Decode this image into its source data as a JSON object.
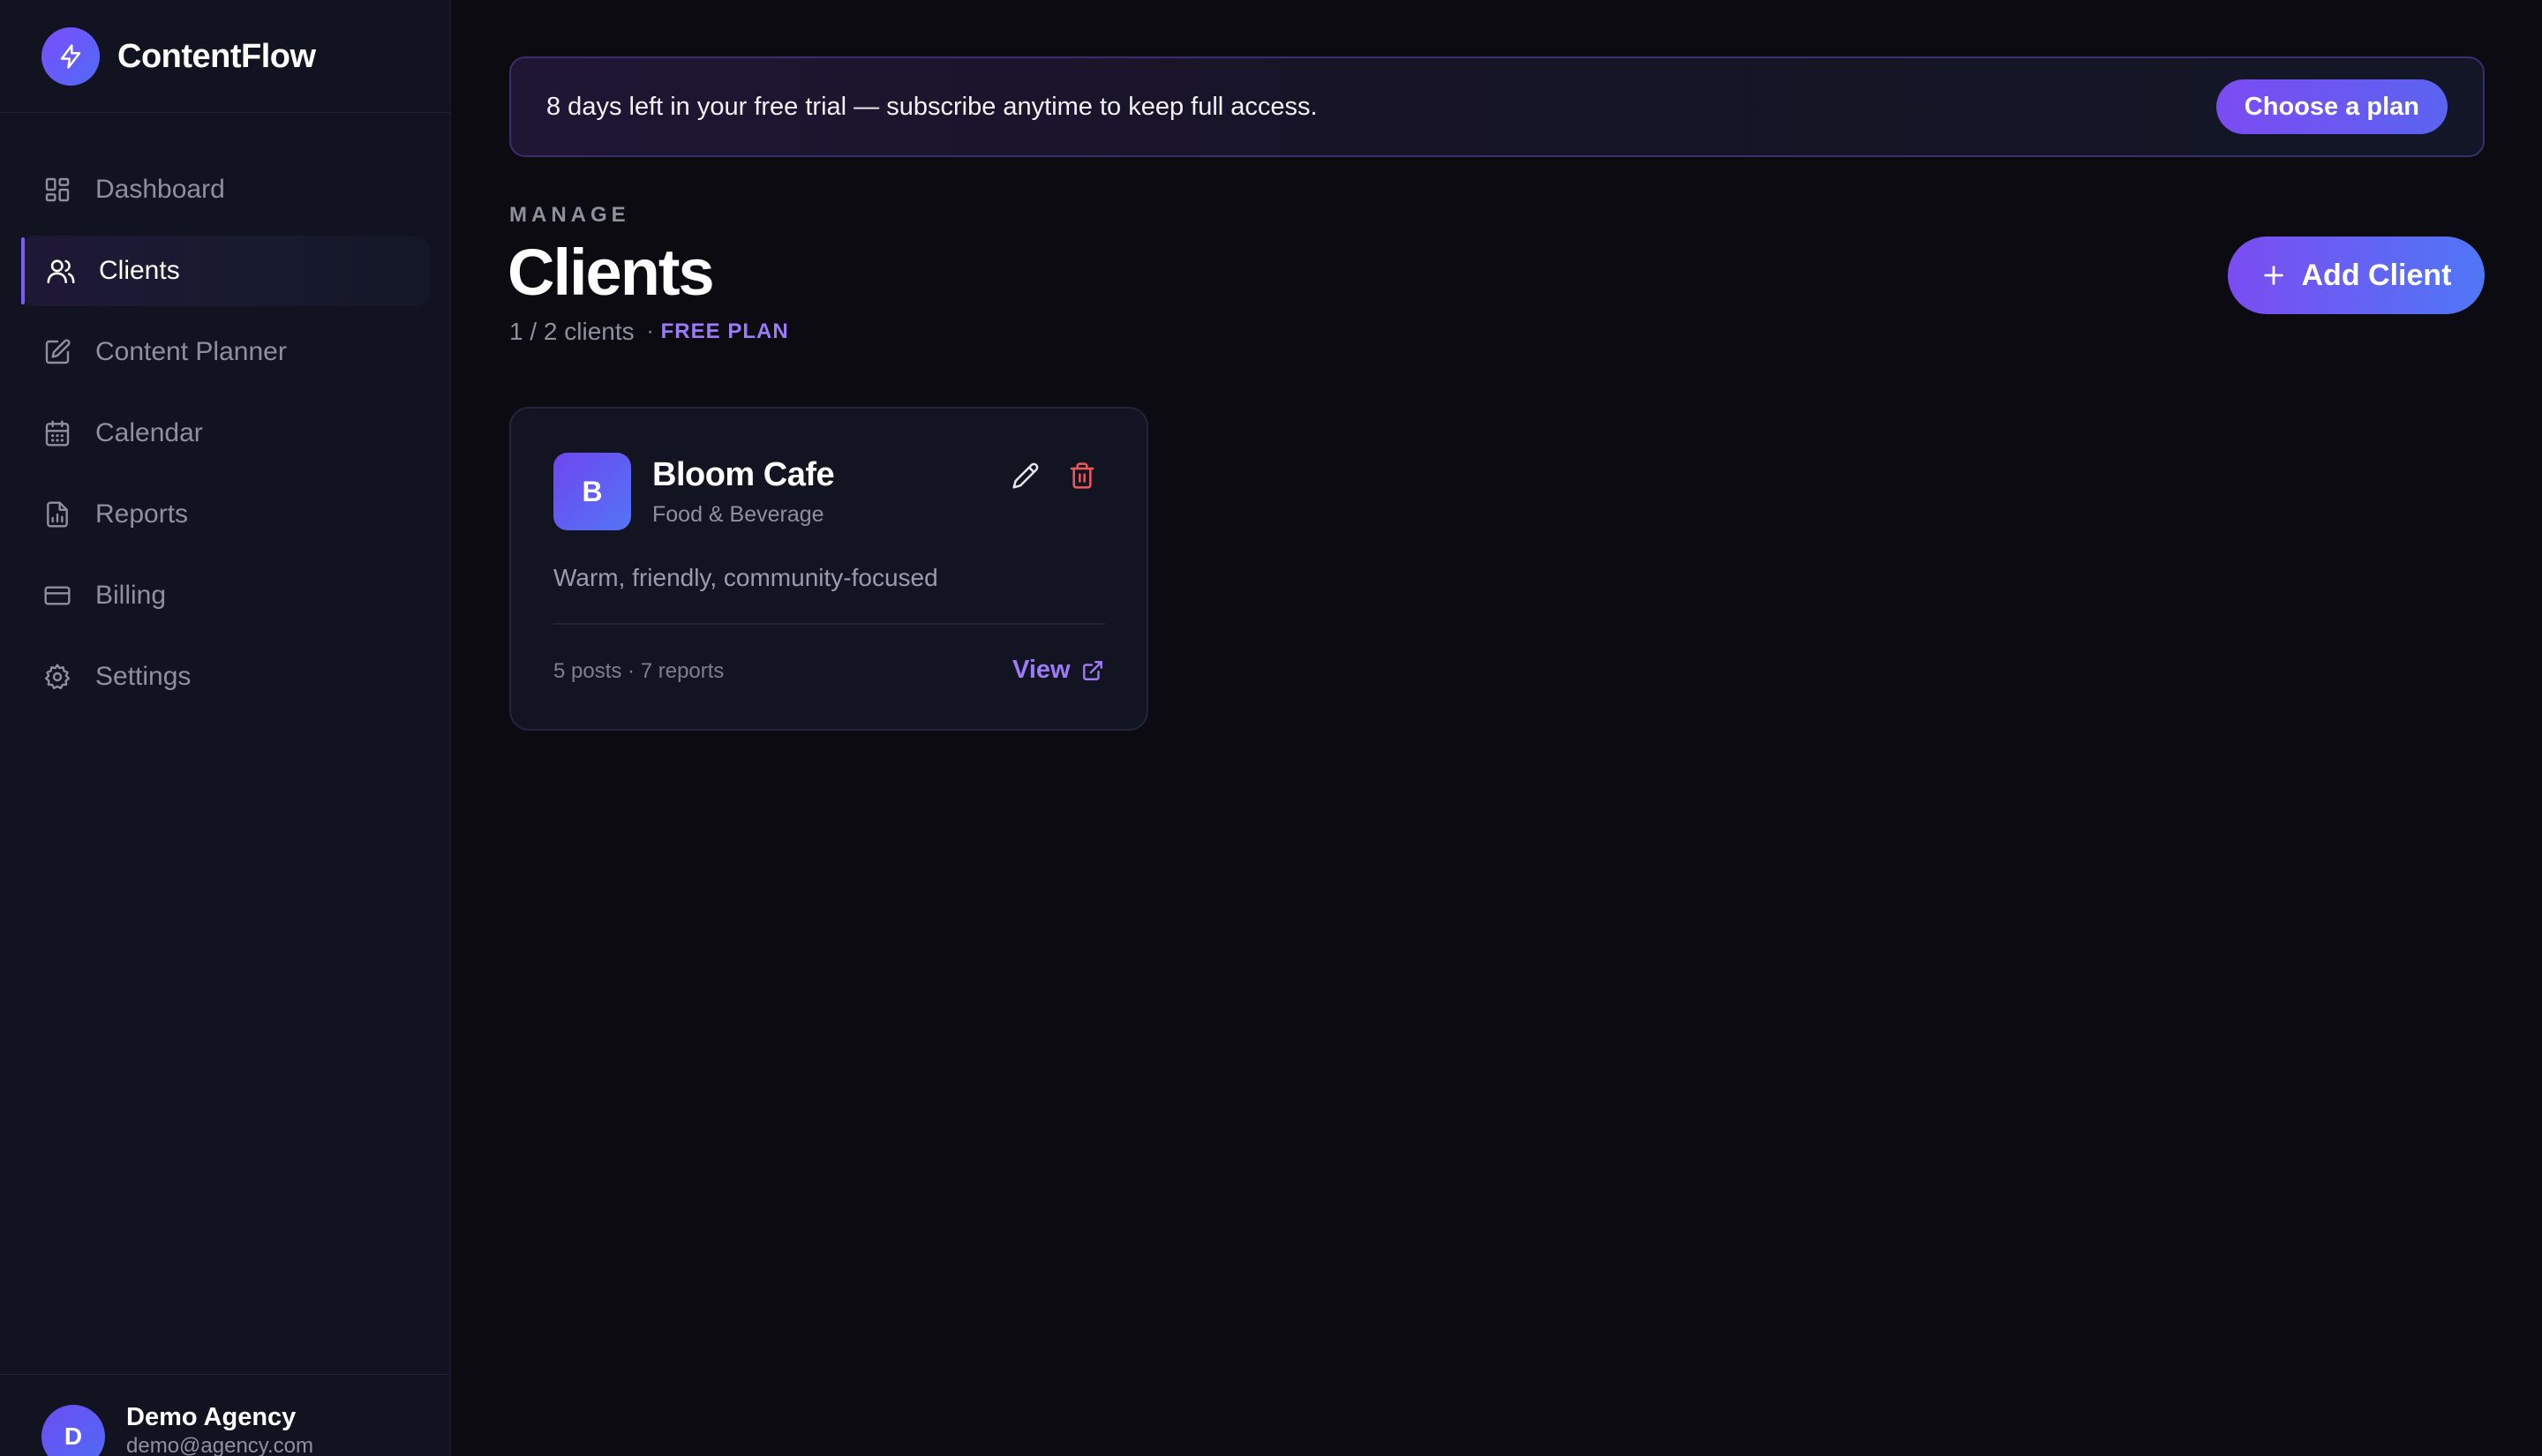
{
  "app": {
    "name": "ContentFlow",
    "logo_icon": "lightning-bolt-icon"
  },
  "sidebar": {
    "items": [
      {
        "label": "Dashboard",
        "icon": "dashboard-grid-icon",
        "active": false
      },
      {
        "label": "Clients",
        "icon": "users-icon",
        "active": true
      },
      {
        "label": "Content Planner",
        "icon": "pencil-square-icon",
        "active": false
      },
      {
        "label": "Calendar",
        "icon": "calendar-icon",
        "active": false
      },
      {
        "label": "Reports",
        "icon": "report-document-icon",
        "active": false
      },
      {
        "label": "Billing",
        "icon": "credit-card-icon",
        "active": false
      },
      {
        "label": "Settings",
        "icon": "gear-icon",
        "active": false
      }
    ],
    "account": {
      "initial": "D",
      "name": "Demo Agency",
      "email": "demo@agency.com"
    }
  },
  "banner": {
    "text": "8 days left in your free trial — subscribe anytime to keep full access.",
    "button_label": "Choose a plan"
  },
  "header": {
    "overline": "MANAGE",
    "title": "Clients",
    "client_count": "1 / 2 clients",
    "separator": "·",
    "plan": "FREE PLAN",
    "add_button_label": "Add Client"
  },
  "clients": [
    {
      "initial": "B",
      "name": "Bloom Cafe",
      "industry": "Food & Beverage",
      "tone": "Warm, friendly, community-focused",
      "stats": "5 posts · 7 reports",
      "view_label": "View"
    }
  ],
  "colors": {
    "accent": "#7c5cf5",
    "background": "#0c0b11",
    "sidebar": "#111320",
    "danger": "#f0565c"
  }
}
